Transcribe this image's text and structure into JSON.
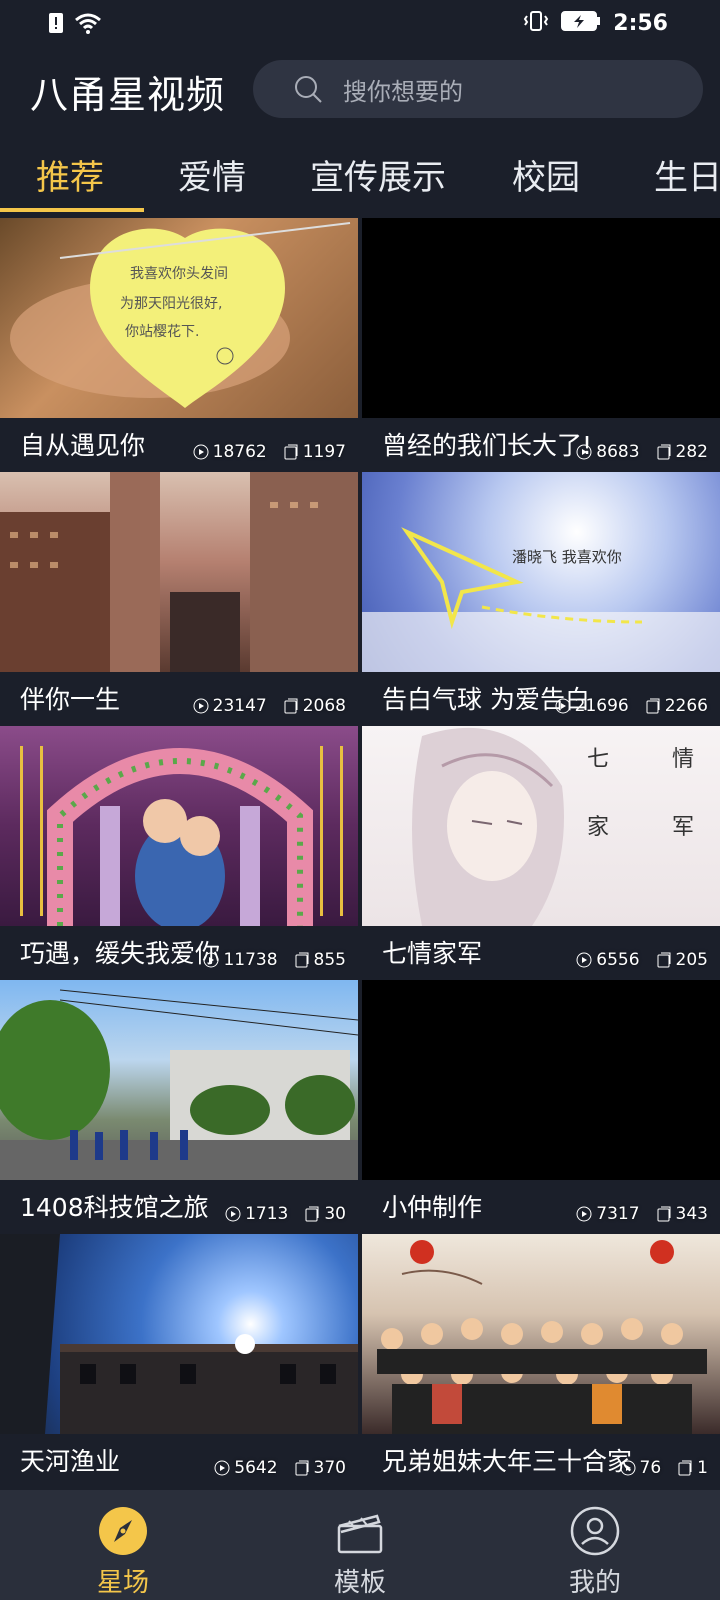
{
  "status_bar": {
    "time": "2:56"
  },
  "header": {
    "app_title": "八甬星视频",
    "search_placeholder": "搜你想要的"
  },
  "tabs": [
    {
      "label": "推荐",
      "active": true
    },
    {
      "label": "爱情"
    },
    {
      "label": "宣传展示"
    },
    {
      "label": "校园"
    },
    {
      "label": "生日"
    }
  ],
  "cards": [
    {
      "title": "自从遇见你",
      "views": "18762",
      "uses": "1197"
    },
    {
      "title": "曾经的我们长大了!",
      "views": "8683",
      "uses": "282"
    },
    {
      "title": "伴你一生",
      "views": "23147",
      "uses": "2068"
    },
    {
      "title": "告白气球 为爱告白",
      "views": "21696",
      "uses": "2266"
    },
    {
      "title": "巧遇，缓失我爱你",
      "views": "11738",
      "uses": "855"
    },
    {
      "title": "七情家军",
      "views": "6556",
      "uses": "205"
    },
    {
      "title": "1408科技馆之旅",
      "views": "1713",
      "uses": "30"
    },
    {
      "title": "小仲制作",
      "views": "7317",
      "uses": "343"
    },
    {
      "title": "天河渔业",
      "views": "5642",
      "uses": "370"
    },
    {
      "title": "兄弟姐妹大年三十合家",
      "views": "76",
      "uses": "1"
    }
  ],
  "bottom_nav": [
    {
      "label": "星场",
      "icon": "compass-icon",
      "active": true
    },
    {
      "label": "模板",
      "icon": "clapperboard-icon"
    },
    {
      "label": "我的",
      "icon": "profile-icon"
    }
  ],
  "colors": {
    "accent": "#f4c64a",
    "background": "#1b1f2a",
    "nav_bg": "#2a2f3b",
    "search_bg": "#2f3442"
  }
}
